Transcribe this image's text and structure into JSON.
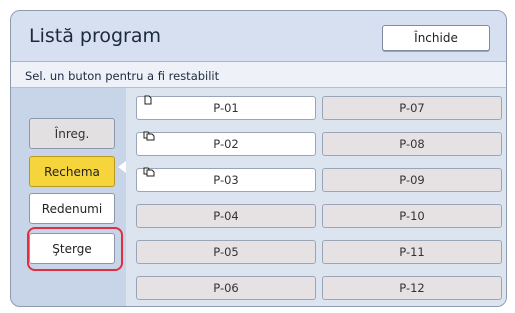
{
  "window": {
    "title": "Listă program"
  },
  "header": {
    "close_label": "Închide"
  },
  "instruction": "Sel. un buton pentru a fi restabilit",
  "actions": {
    "register_label": "Înreg.",
    "recall_label": "Rechema",
    "rename_label": "Redenumi",
    "delete_label": "Şterge"
  },
  "programs": [
    {
      "label": "P-01",
      "stored": true,
      "icon": "single-page-icon"
    },
    {
      "label": "P-02",
      "stored": true,
      "icon": "multi-page-icon"
    },
    {
      "label": "P-03",
      "stored": true,
      "icon": "multi-page-icon"
    },
    {
      "label": "P-04",
      "stored": false
    },
    {
      "label": "P-05",
      "stored": false
    },
    {
      "label": "P-06",
      "stored": false
    },
    {
      "label": "P-07",
      "stored": false
    },
    {
      "label": "P-08",
      "stored": false
    },
    {
      "label": "P-09",
      "stored": false
    },
    {
      "label": "P-10",
      "stored": false
    },
    {
      "label": "P-11",
      "stored": false
    },
    {
      "label": "P-12",
      "stored": false
    }
  ],
  "colors": {
    "accent_selected": "#f6d53c",
    "highlight": "#e03040",
    "panel": "#c8d4e8"
  }
}
